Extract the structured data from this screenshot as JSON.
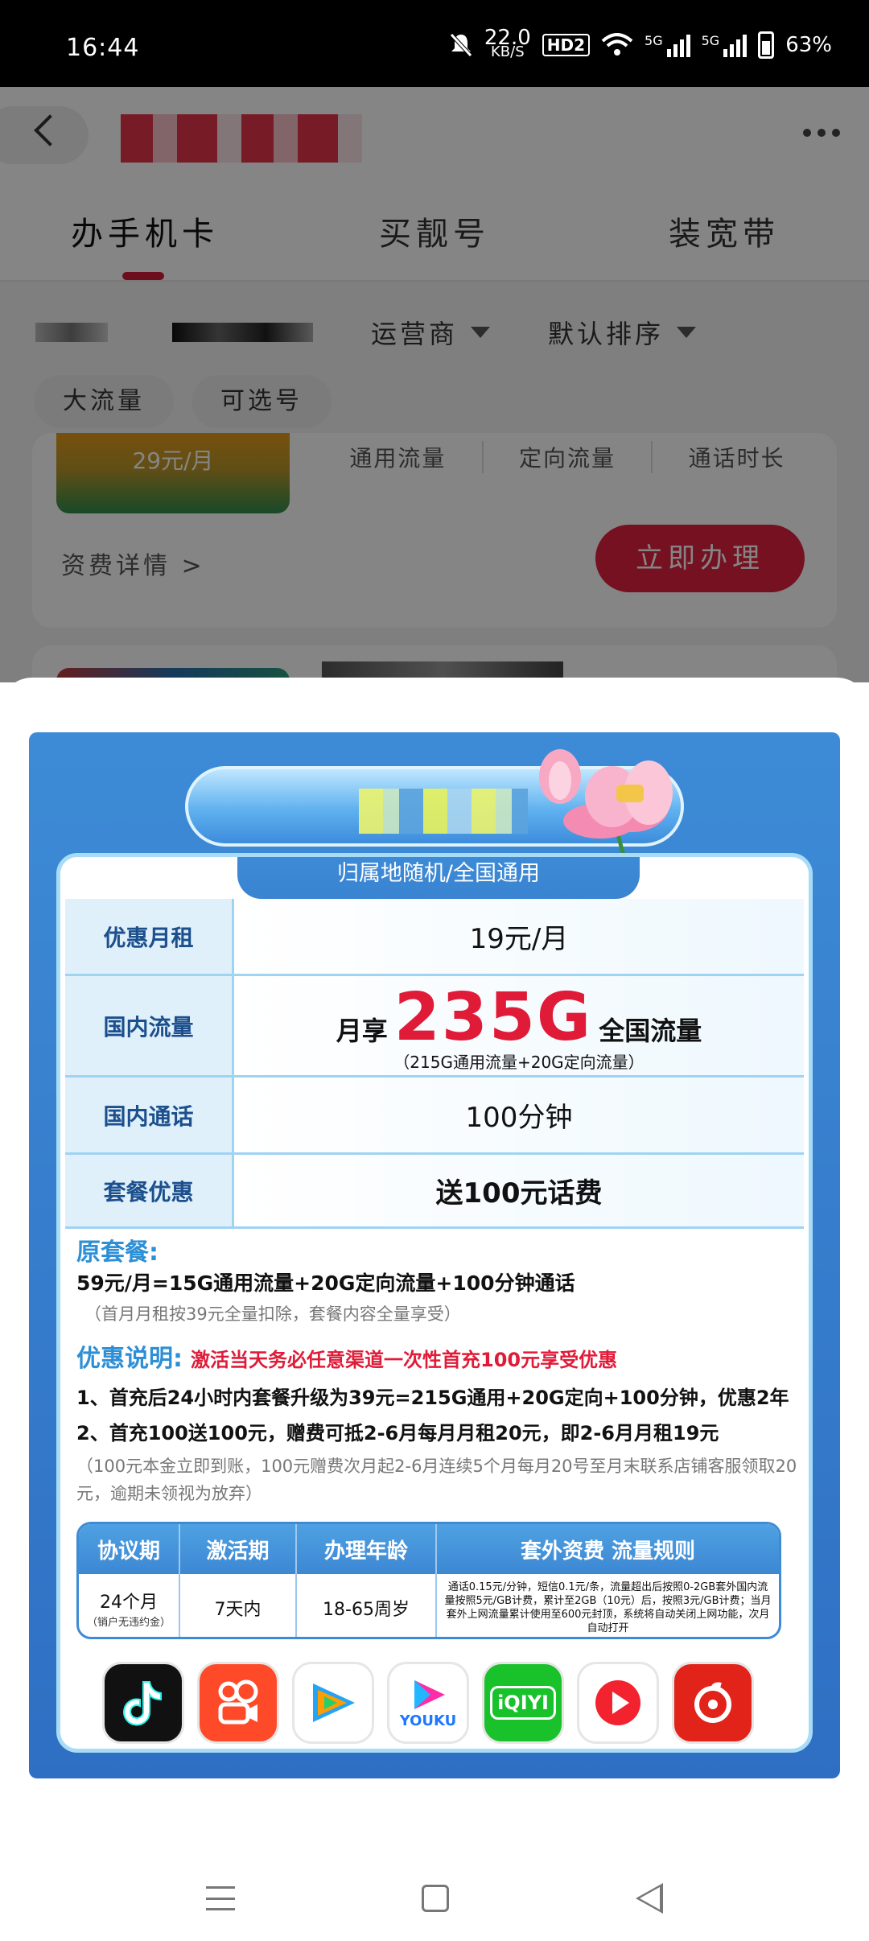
{
  "status_bar": {
    "time": "16:44",
    "net_speed": "22.0",
    "net_unit": "KB/S",
    "hd_badge": "HD2",
    "sim1": "5G",
    "sim2": "5G",
    "battery": "63%",
    "icons": [
      "mute-icon",
      "wifi-icon",
      "signal-icon",
      "battery-icon"
    ]
  },
  "app": {
    "tabs": [
      {
        "label": "办手机卡"
      },
      {
        "label": "买靓号"
      },
      {
        "label": "装宽带"
      }
    ],
    "filters": {
      "carrier": "运营商",
      "sort": "默认排序"
    },
    "chips": [
      "大流量",
      "可选号"
    ],
    "plan": {
      "thumb_price": "29元/月",
      "cols": [
        "通用流量",
        "定向流量",
        "通话时长"
      ],
      "detail": "资费详情 >",
      "apply": "立即办理"
    }
  },
  "poster": {
    "attribution": "归属地随机/全国通用",
    "rows": [
      {
        "label": "优惠月租",
        "value": "19元/月"
      },
      {
        "label": "国内流量",
        "prefix": "月享",
        "big": "235G",
        "suffix": "全国流量",
        "sub": "（215G通用流量+20G定向流量）"
      },
      {
        "label": "国内通话",
        "value": "100分钟"
      },
      {
        "label": "套餐优惠",
        "value": "送100元话费"
      }
    ],
    "original_title": "原套餐:",
    "original_text": "59元/月=15G通用流量+20G定向流量+100分钟通话",
    "original_note": "（首月月租按39元全量扣除，套餐内容全量享受）",
    "pref_title": "优惠说明:",
    "pref_red": "激活当天务必任意渠道一次性首充100元享受优惠",
    "pref_line1": "1、首充后24小时内套餐升级为39元=215G通用+20G定向+100分钟，优惠2年",
    "pref_line2": "2、首充100送100元，赠费可抵2-6月每月月租20元，即2-6月月租19元",
    "pref_note": "（100元本金立即到账，100元赠费次月起2-6月连续5个月每月20号至月末联系店铺客服领取20元，逾期未领视为放弃）",
    "terms": {
      "headers": [
        "协议期",
        "激活期",
        "办理年龄",
        "套外资费   流量规则"
      ],
      "contract": "24个月",
      "contract_note": "（销户无违约金）",
      "activation": "7天内",
      "age": "18-65周岁",
      "extra": "通话0.15元/分钟，短信0.1元/条，流量超出后按照0-2GB套外国内流量按照5元/GB计费，累计至2GB（10元）后，按照3元/GB计费；当月套外上网流量累计使用至600元封顶，系统将自动关闭上网功能，次月自动打开"
    },
    "apps": [
      {
        "name": "douyin-icon",
        "color": "#111111",
        "label": "♪"
      },
      {
        "name": "kuaishou-icon",
        "color": "#ff4a2a",
        "label": "▶"
      },
      {
        "name": "tencent-video-icon",
        "color": "#ffffff",
        "label": "▶"
      },
      {
        "name": "youku-icon",
        "color": "#ffffff",
        "label": "YOUKU"
      },
      {
        "name": "iqiyi-icon",
        "color": "#19c22b",
        "label": "iQIYI"
      },
      {
        "name": "play-icon",
        "color": "#ffffff",
        "label": "▶"
      },
      {
        "name": "netease-music-icon",
        "color": "#e2231a",
        "label": "♫"
      }
    ]
  }
}
